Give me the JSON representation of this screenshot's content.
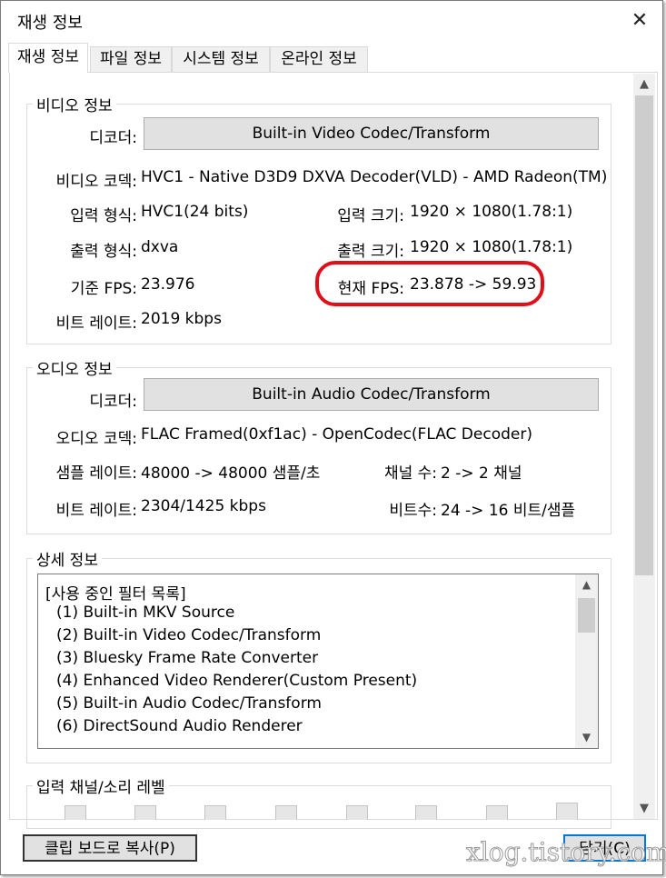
{
  "window": {
    "title": "재생 정보",
    "close_glyph": "✕"
  },
  "tabs": [
    {
      "label": "재생 정보",
      "active": true
    },
    {
      "label": "파일 정보",
      "active": false
    },
    {
      "label": "시스템 정보",
      "active": false
    },
    {
      "label": "온라인 정보",
      "active": false
    }
  ],
  "video": {
    "group_label": "비디오 정보",
    "decoder_label": "디코더:",
    "decoder_value": "Built-in Video Codec/Transform",
    "codec_label": "비디오 코덱:",
    "codec_value": "HVC1 - Native D3D9 DXVA Decoder(VLD) - AMD Radeon(TM)",
    "input_format_label": "입력 형식:",
    "input_format_value": "HVC1(24 bits)",
    "input_size_label": "입력 크기:",
    "input_size_value": "1920 × 1080(1.78:1)",
    "output_format_label": "출력 형식:",
    "output_format_value": "dxva",
    "output_size_label": "출력 크기:",
    "output_size_value": "1920 × 1080(1.78:1)",
    "base_fps_label": "기준 FPS:",
    "base_fps_value": "23.976",
    "current_fps_label": "현재 FPS:",
    "current_fps_value": "23.878 -> 59.93",
    "bitrate_label": "비트 레이트:",
    "bitrate_value": "2019 kbps"
  },
  "audio": {
    "group_label": "오디오 정보",
    "decoder_label": "디코더:",
    "decoder_value": "Built-in Audio Codec/Transform",
    "codec_label": "오디오 코덱:",
    "codec_value": "FLAC Framed(0xf1ac) - OpenCodec(FLAC Decoder)",
    "samplerate_label": "샘플 레이트:",
    "samplerate_value": "48000 -> 48000 샘플/초",
    "channels_label": "채널 수:",
    "channels_value": "2 -> 2 채널",
    "bitrate_label": "비트 레이트:",
    "bitrate_value": "2304/1425 kbps",
    "bits_label": "비트수:",
    "bits_value": "24 -> 16 비트/샘플"
  },
  "details": {
    "group_label": "상세 정보",
    "lines": [
      "[사용 중인 필터 목록]",
      "(1) Built-in MKV Source",
      "(2) Built-in Video Codec/Transform",
      "(3) Bluesky Frame Rate Converter",
      "(4) Enhanced Video Renderer(Custom Present)",
      "(5) Built-in Audio Codec/Transform",
      "(6) DirectSound Audio Renderer"
    ]
  },
  "levels": {
    "group_label": "입력 채널/소리 레벨",
    "meter_count": 8
  },
  "footer": {
    "copy_label": "클립 보드로 복사(P)",
    "close_label": "닫기(C)"
  },
  "watermark": "xlog.tistory.com",
  "colors": {
    "highlight": "#e0101a",
    "accent": "#0078d7"
  }
}
